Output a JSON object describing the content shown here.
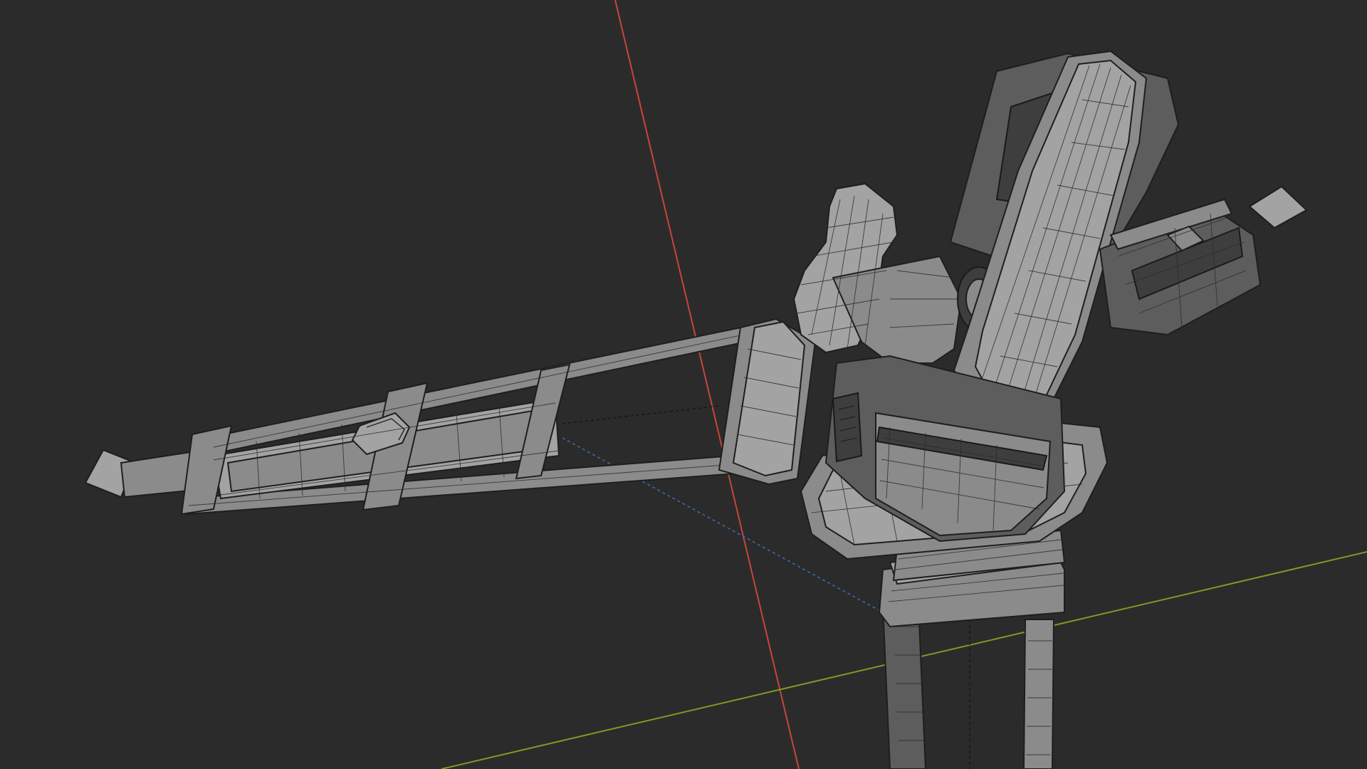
{
  "viewport": {
    "background": "#2b2b2b",
    "shading_mode": "solid-wireframe",
    "object_color": "#8b8b8b"
  },
  "axes": {
    "x_axis_color": "#c8443d",
    "y_axis_color": "#7b9c23",
    "z_axis_color": "#3b6fb3"
  },
  "icons": {
    "model": "robotic-arm-model-icon",
    "grid_x": "axis-line-icon",
    "grid_y": "axis-line-icon"
  }
}
